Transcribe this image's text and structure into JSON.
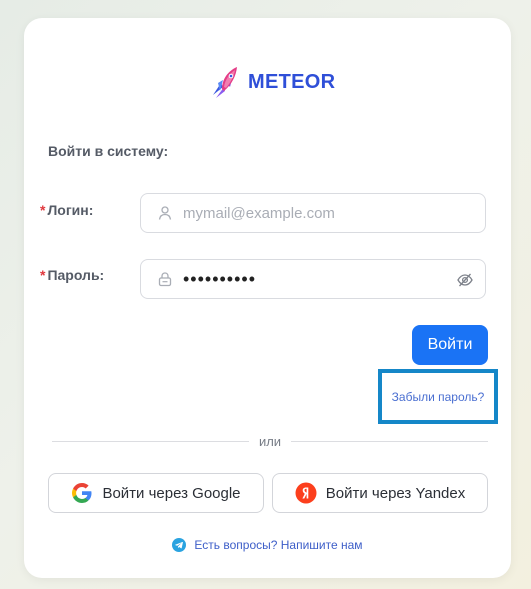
{
  "brand": {
    "name": "METEOR",
    "icon": "rocket-logo-icon"
  },
  "heading": "Войти в систему:",
  "fields": {
    "login": {
      "required_mark": "*",
      "label": "Логин:",
      "placeholder": "mymail@example.com",
      "icon": "user-icon"
    },
    "password": {
      "required_mark": "*",
      "label": "Пароль:",
      "value": "••••••••••",
      "icon": "lock-icon",
      "toggle_icon": "eye-off-icon"
    }
  },
  "actions": {
    "login_label": "Войти",
    "forgot_label": "Забыли пароль?",
    "divider_label": "или",
    "google_label": "Войти через Google",
    "yandex_label": "Войти через Yandex"
  },
  "help": {
    "label": "Есть вопросы? Напишите нам",
    "icon": "telegram-icon"
  },
  "colors": {
    "primary": "#1a73f5",
    "brand": "#2f4fd8",
    "required": "#e0383e",
    "highlight": "#1587c8"
  }
}
